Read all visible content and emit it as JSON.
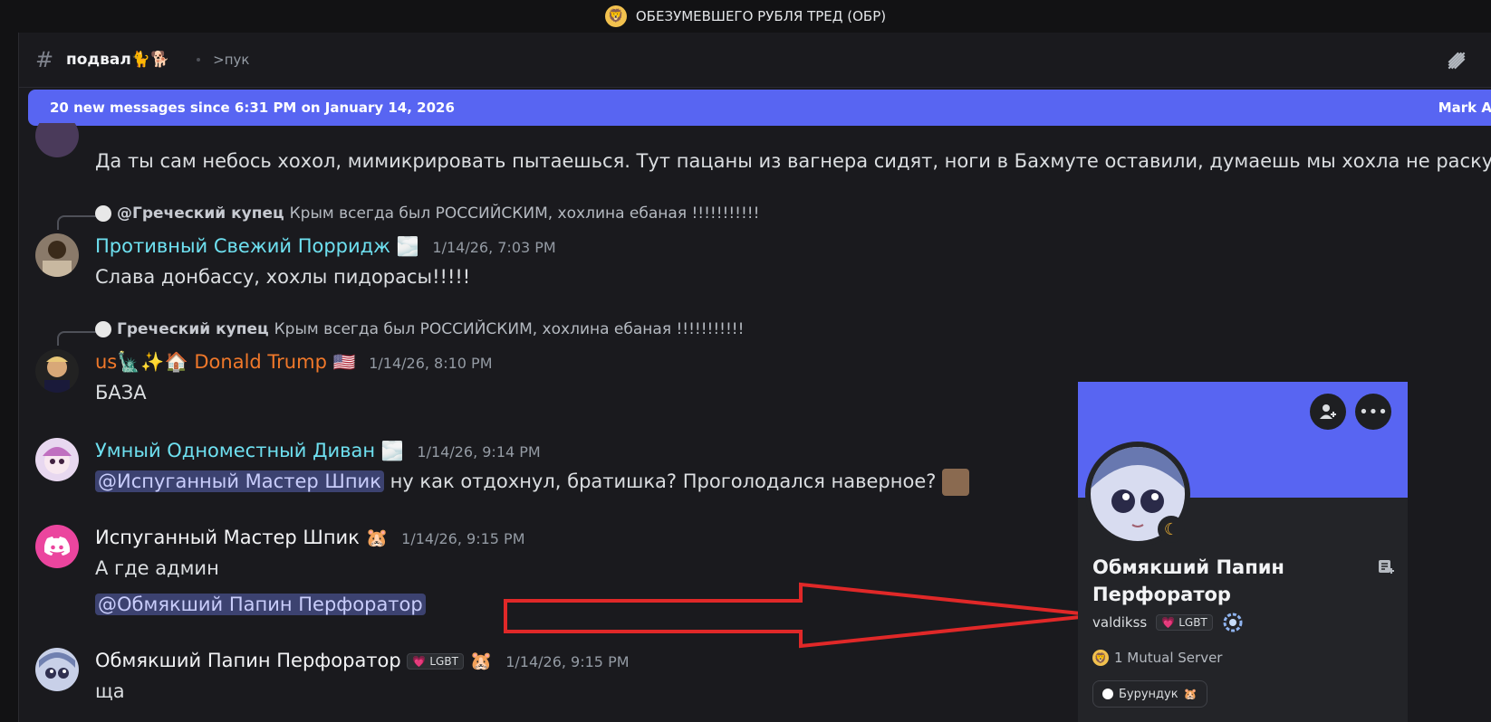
{
  "window": {
    "title": "ОБЕЗУМЕВШЕГО РУБЛЯ ТРЕД (ОБР)",
    "server_icon": "🦁"
  },
  "header": {
    "hash": "#",
    "channel_name": "подвал🐈🐕",
    "topic": ">пук"
  },
  "banner": {
    "text": "20 new messages since 6:31 PM on January 14, 2026",
    "mark_label": "Mark A"
  },
  "messages": [
    {
      "text": "Да ты сам небось хохол, мимикрировать пытаешься. Тут пацаны из вагнера сидят, ноги в Бахмуте оставили, думаешь мы хохла не раскусим"
    },
    {
      "reply_name": "@Греческий купец",
      "reply_text": "Крым всегда был РОССИЙСКИМ, хохлина ебаная !!!!!!!!!!!",
      "author": "Противный Свежий Порридж",
      "author_color": "#6ee0f0",
      "author_emoji": "🌫️",
      "timestamp": "1/14/26, 7:03 PM",
      "text": "Слава донбассу, хохлы пидорасы!!!!!"
    },
    {
      "reply_name": "Греческий купец",
      "reply_text": "Крым всегда был РОССИЙСКИМ, хохлина ебаная !!!!!!!!!!!",
      "author_prefix": "us🗽✨🏠",
      "author": "Donald Trump",
      "author_color": "#f0782a",
      "author_emoji": "🇺🇸",
      "timestamp": "1/14/26, 8:10 PM",
      "text": "БАЗА"
    },
    {
      "author": "Умный Одноместный Диван",
      "author_color": "#6ee0f0",
      "author_emoji": "🌫️",
      "timestamp": "1/14/26, 9:14 PM",
      "mention": "@Испуганный Мастер Шпик",
      "text": "ну как отдохнул, братишка? Проголодался наверное?"
    },
    {
      "author": "Испуганный Мастер Шпик",
      "author_color": "#f2f3f5",
      "author_emoji": "🐹",
      "timestamp": "1/14/26, 9:15 PM",
      "text": "А где админ",
      "mention2": "@Обмякший Папин Перфоратор"
    },
    {
      "author": "Обмякший Папин Перфоратор",
      "author_color": "#f2f3f5",
      "badge": "LGBT",
      "author_emoji": "🐹",
      "timestamp": "1/14/26, 9:15 PM",
      "text": "ща"
    }
  ],
  "popout": {
    "name": "Обмякший Папин Перфоратор",
    "username": "valdikss",
    "badge": "LGBT",
    "mutual": "1 Mutual Server",
    "role": "Бурундук",
    "banner_color": "#5865f2"
  }
}
